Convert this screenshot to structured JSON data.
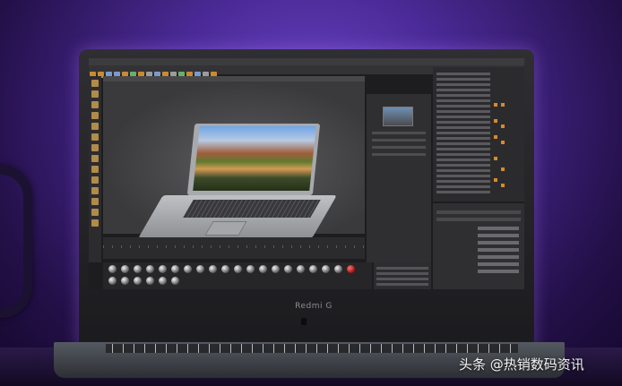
{
  "laptop": {
    "brand_label": "Redmi G"
  },
  "watermark": {
    "text": "头条 @热销数码资讯"
  }
}
